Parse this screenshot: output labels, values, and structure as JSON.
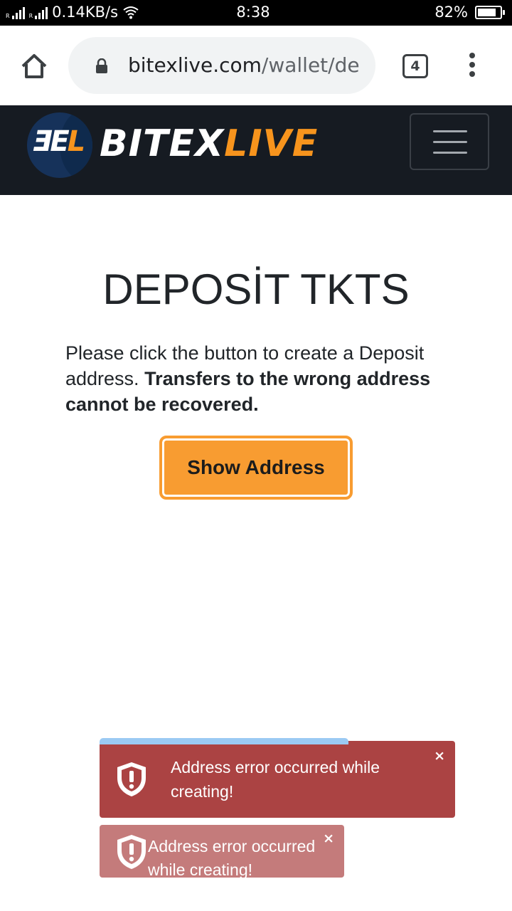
{
  "status_bar": {
    "network_speed": "0.14KB/s",
    "time": "8:38",
    "battery_percent": "82%",
    "battery_level": 0.82,
    "icons": [
      "signal-icon",
      "wifi-icon",
      "battery-icon"
    ]
  },
  "browser": {
    "url_host": "bitexlive.com",
    "url_path": "/wallet/de",
    "tab_count": "4",
    "icons": [
      "home-icon",
      "lock-icon",
      "tabs-icon",
      "overflow-menu-icon"
    ]
  },
  "navbar": {
    "logo_mark_white": "ƎE",
    "logo_mark_orange": "L",
    "logo_brand_white": "BITEX",
    "logo_brand_orange": "LIVE",
    "background_color": "#161b22",
    "accent_color": "#f7941d"
  },
  "main": {
    "title": "DEPOSİT TKTS",
    "intro_normal": "Please click the button to create a Deposit address.",
    "intro_bold": "Transfers to the wrong address cannot be recovered.",
    "show_address_label": "Show Address",
    "button_color": "#f89c31"
  },
  "toasts": [
    {
      "message": "Address error occurred while creating!",
      "close": "×",
      "icon": "shield-alert-icon",
      "color": "#ab4343"
    },
    {
      "message": "Address error occurred while creating!",
      "close": "×",
      "icon": "shield-alert-icon",
      "color": "#c47b7b"
    }
  ],
  "toast_progress_color": "#9bcaf3"
}
